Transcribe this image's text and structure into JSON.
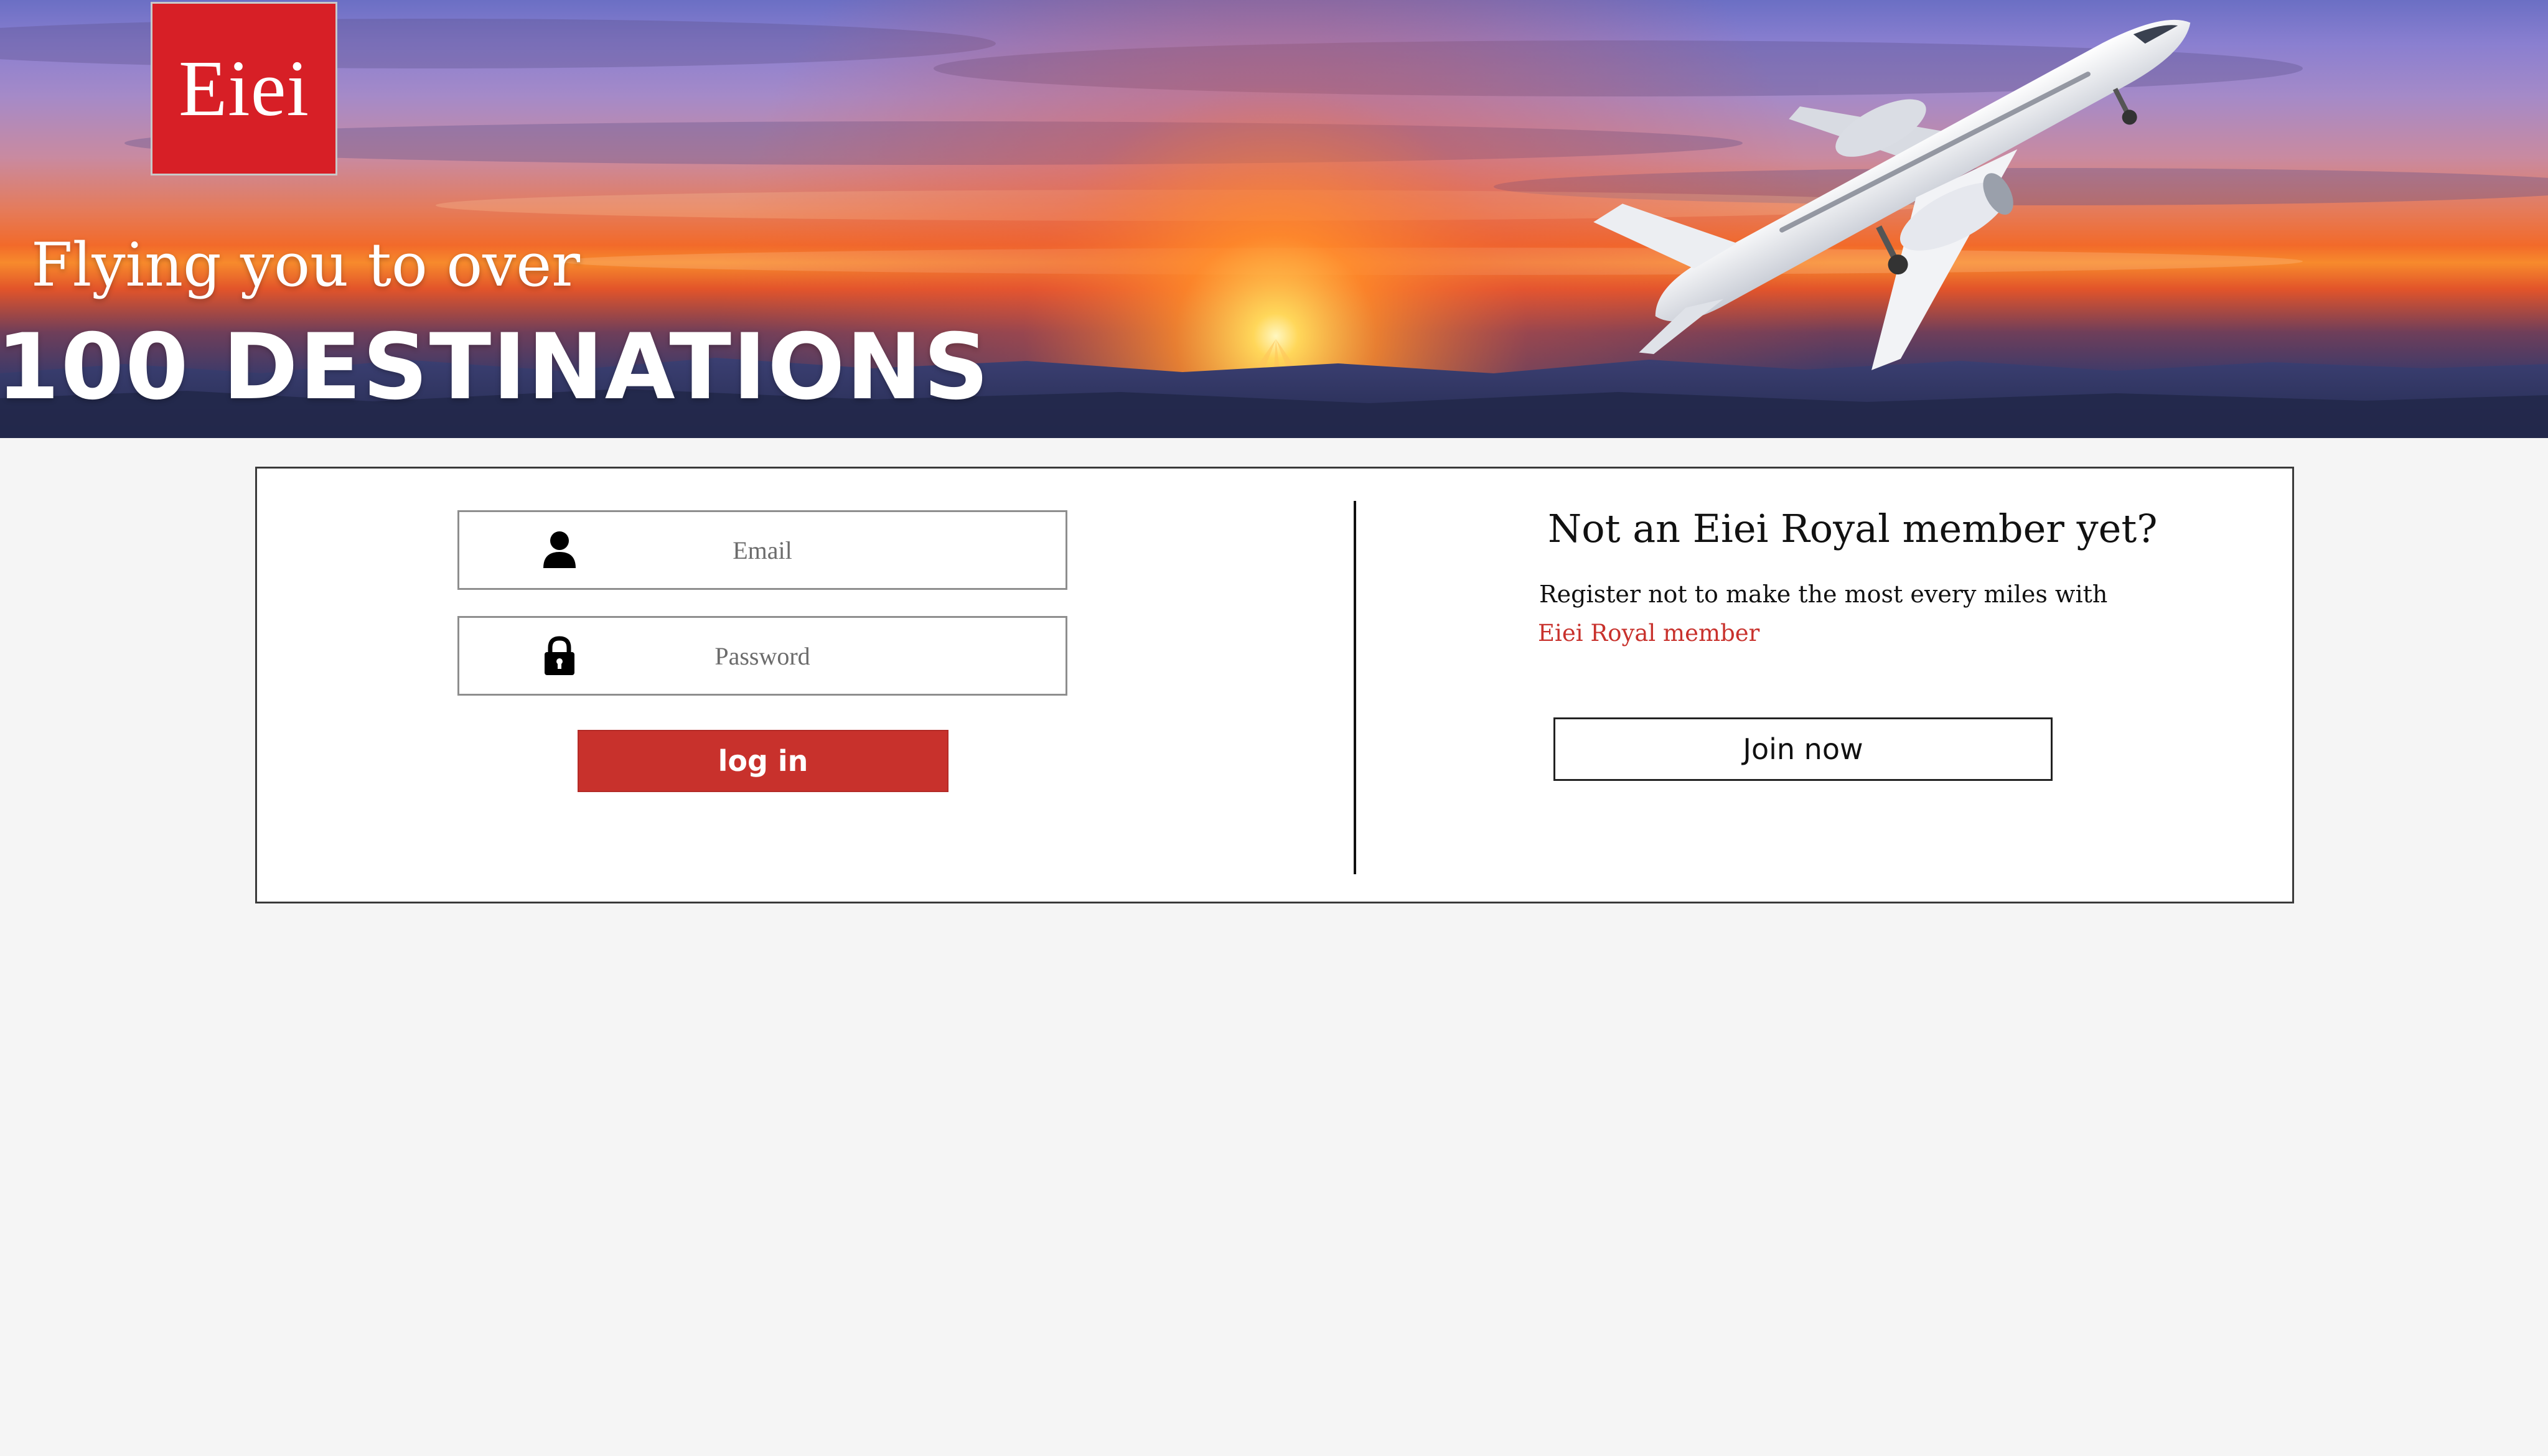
{
  "brand": {
    "logo_text": "Eiei",
    "logo_color": "#d71f26"
  },
  "hero": {
    "line1": "Flying you to over",
    "line2": "100 DESTINATIONS"
  },
  "login": {
    "email_placeholder": "Email",
    "password_placeholder": "Password",
    "email_icon": "user-icon",
    "password_icon": "lock-icon",
    "login_label": "log in",
    "accent": "#c8312c"
  },
  "register": {
    "title": "Not an Eiei Royal member yet?",
    "text": "Register not to make the most every miles with",
    "link": "Eiei Royal member",
    "join_label": "Join now"
  }
}
